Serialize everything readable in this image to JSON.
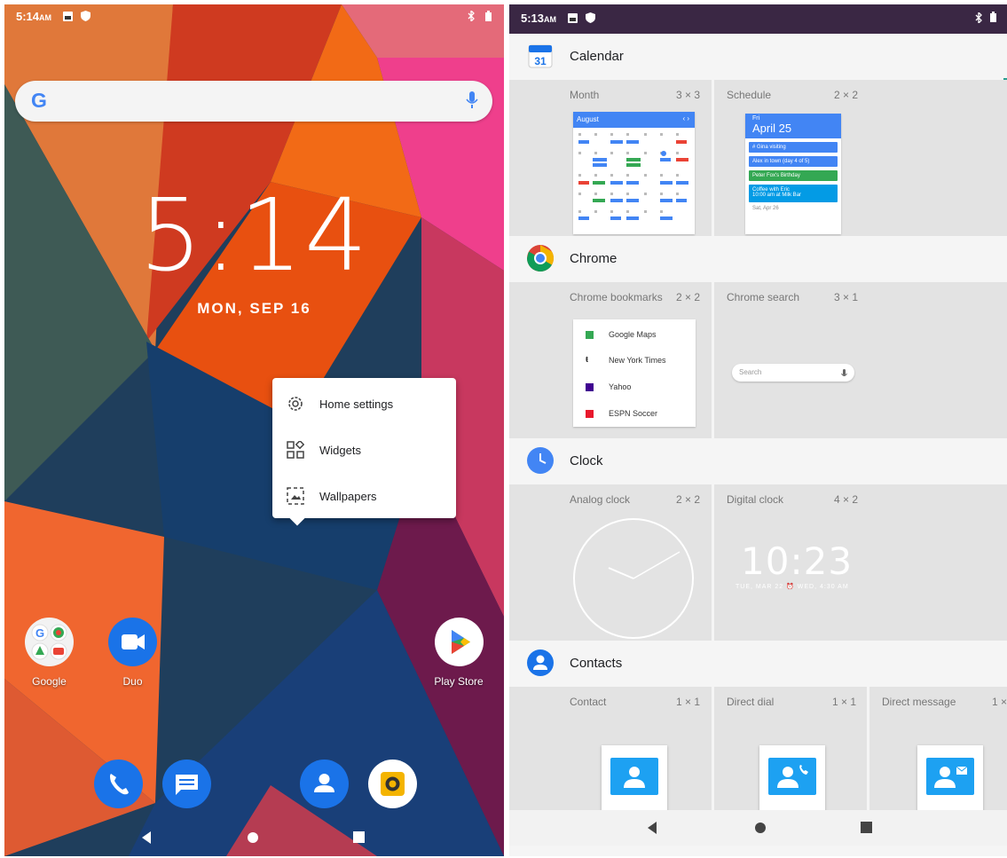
{
  "home": {
    "status": {
      "time": "5:14",
      "ampm": "AM"
    },
    "clock": "5:14",
    "date": "MON, SEP 16",
    "menu": [
      {
        "label": "Home settings",
        "icon": "gear-icon"
      },
      {
        "label": "Widgets",
        "icon": "widgets-icon"
      },
      {
        "label": "Wallpapers",
        "icon": "wallpaper-icon"
      }
    ],
    "apps": [
      {
        "label": "Google"
      },
      {
        "label": "Duo"
      },
      {
        "label": "Play Store"
      }
    ]
  },
  "picker": {
    "status": {
      "time": "5:13",
      "ampm": "AM"
    },
    "calendar": {
      "name": "Calendar",
      "icon_text": "31",
      "month": {
        "title": "Month",
        "dim": "3 × 3",
        "header": "August"
      },
      "schedule": {
        "title": "Schedule",
        "dim": "2 × 2",
        "day": "Fri",
        "date": "April 25",
        "events": [
          "# Gina visiting",
          "Alex in town (day 4 of 5)",
          "Peter Fox's Birthday",
          "Coffee with Eric"
        ],
        "event_sub": "10:00 am at Milk Bar",
        "footer": "Sat, Apr 26"
      }
    },
    "chrome": {
      "name": "Chrome",
      "bookmarks": {
        "title": "Chrome bookmarks",
        "dim": "2 × 2",
        "items": [
          "Google Maps",
          "New York Times",
          "Yahoo",
          "ESPN Soccer"
        ]
      },
      "search": {
        "title": "Chrome search",
        "dim": "3 × 1",
        "placeholder": "Search"
      }
    },
    "clock": {
      "name": "Clock",
      "analog": {
        "title": "Analog clock",
        "dim": "2 × 2"
      },
      "digital": {
        "title": "Digital clock",
        "dim": "4 × 2",
        "time": "10:23",
        "sub": "TUE, MAR 22  ⏰ WED, 4:30 AM"
      }
    },
    "contacts": {
      "name": "Contacts",
      "contact": {
        "title": "Contact",
        "dim": "1 × 1"
      },
      "dial": {
        "title": "Direct dial",
        "dim": "1 × 1"
      },
      "message": {
        "title": "Direct message",
        "dim": "1 ×"
      }
    }
  }
}
